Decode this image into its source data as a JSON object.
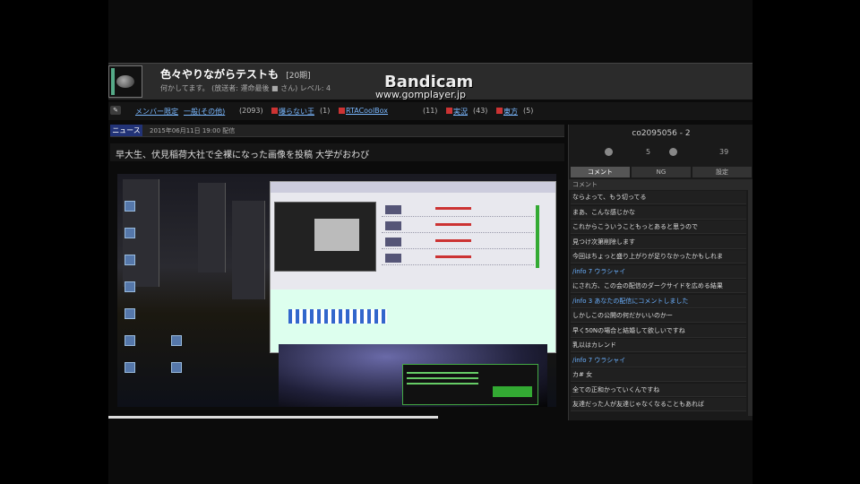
{
  "header": {
    "title": "色々やりながらテストも",
    "title_badge": "[20期]",
    "subtitle": "何かしてます。 (放送者: 運命最後 ■ さん)  レベル: 4",
    "watermark_1": "Bandicam",
    "watermark_2": "www.gomplayer.jp"
  },
  "community_bar": {
    "icon": "tag-icon",
    "items": [
      {
        "text": "メンバー限定",
        "style": "blue"
      },
      {
        "text": "一般(その他)",
        "style": "blue"
      },
      {
        "text": "(2093)",
        "style": "plain"
      },
      {
        "text": "爆らない王",
        "style": "blue"
      },
      {
        "text": "(1)",
        "style": "plain"
      },
      {
        "text": "RTACoolBox",
        "style": "blue"
      },
      {
        "text": "(11)",
        "style": "plain"
      },
      {
        "text": "実況",
        "style": "blue"
      },
      {
        "text": "(43)",
        "style": "plain"
      },
      {
        "text": "東方",
        "style": "blue"
      },
      {
        "text": "(5)",
        "style": "plain"
      }
    ]
  },
  "news": {
    "badge": "ニュース",
    "date": "2015年06月11日 19:00 配信",
    "headline": "早大生、伏見稲荷大社で全裸になった画像を投稿 大学がおわび"
  },
  "panel": {
    "id": "co2095056 - 2",
    "stats": [
      "",
      "5",
      "",
      "39"
    ],
    "tabs": [
      "コメント",
      "NG",
      "設定"
    ],
    "column_header": "コメント",
    "comments": [
      {
        "text": "ならよって、もう切ってる",
        "style": "normal"
      },
      {
        "text": "まあ、こんな感じかな",
        "style": "normal"
      },
      {
        "text": "これからこういうこともっとあると思うので",
        "style": "normal"
      },
      {
        "text": "見つけ次第削除します",
        "style": "normal"
      },
      {
        "text": "今回はちょっと盛り上がりが足りなかったかもしれま",
        "style": "normal"
      },
      {
        "text": "/info 7 ウラシャイ",
        "style": "blue"
      },
      {
        "text": "にされ方、この会の配信のダークサイドを広める結果",
        "style": "normal"
      },
      {
        "text": "/info 3 あなたの配信にコメントしました",
        "style": "blue"
      },
      {
        "text": "しかしこの公開の何だかいいのかー",
        "style": "normal"
      },
      {
        "text": "早く50Nの場合と結婚して欲しいですね",
        "style": "normal"
      },
      {
        "text": "乳以はカレンド",
        "style": "normal"
      },
      {
        "text": "/info 7 ウラシャイ",
        "style": "blue"
      },
      {
        "text": "カ#  女",
        "style": "normal"
      },
      {
        "text": "全ての正和かっていくんですね",
        "style": "normal"
      },
      {
        "text": "友達だった人が友達じゃなくなることもあれば",
        "style": "normal"
      }
    ]
  },
  "video": {
    "progress": 0.75
  }
}
